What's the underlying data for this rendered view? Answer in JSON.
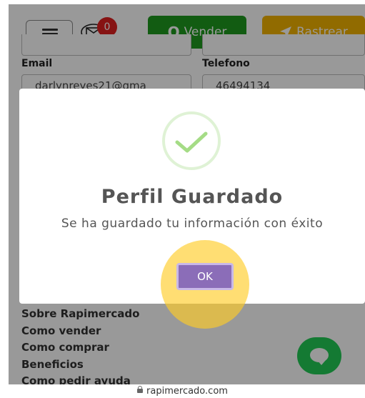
{
  "header": {
    "notification_count": "0",
    "vender_icon": "Q",
    "vender_label": "Vender",
    "rastrear_label": "Rastrear"
  },
  "form": {
    "email_label": "Email",
    "email_value": "darlynreyes21@gma",
    "telefono_label": "Telefono",
    "telefono_value": "46494134"
  },
  "footer": {
    "links": [
      "Sobre Rapimercado",
      "Como vender",
      "Como comprar",
      "Beneficios",
      "Como pedir ayuda"
    ]
  },
  "modal": {
    "title": "Perfil Guardado",
    "message": "Se ha guardado tu información con éxito",
    "ok_label": "OK"
  },
  "browser": {
    "url": "rapimercado.com"
  },
  "colors": {
    "vender_green": "#1f9a1f",
    "rastrear_yellow": "#f2b200",
    "ok_purple": "#8b6db8",
    "chat_green": "#22cc55",
    "badge_red": "#e02020"
  }
}
